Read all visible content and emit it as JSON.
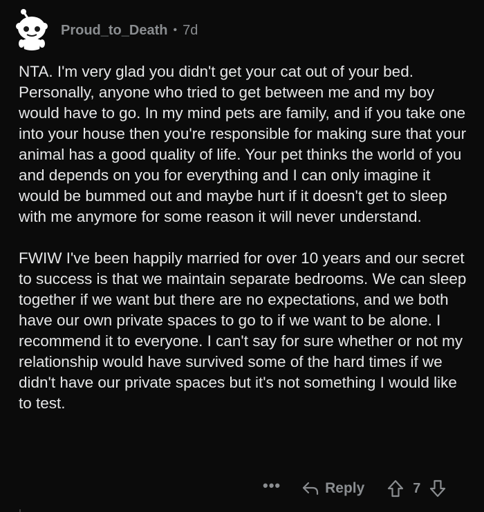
{
  "comment": {
    "author": "Proud_to_Death",
    "separator": "•",
    "age": "7d",
    "paragraphs": [
      "NTA. I'm very glad you didn't get your cat out of your bed. Personally, anyone who tried to get between me and my boy would have to go. In my mind pets are family, and if you take one into your house then you're responsible for making sure that your animal has a good quality of life. Your pet thinks the world of you and depends on you for everything and I can only imagine it would be bummed out and maybe hurt if it doesn't get to sleep with me anymore for some reason it will never understand.",
      "FWIW I've been happily married for over 10 years and our secret to success is that we maintain separate bedrooms. We can sleep together if we want but there are no expectations, and we both have our own private spaces to go to if we want to be alone. I recommend it to everyone. I can't say for sure whether or not my relationship would have survived some of the hard times if we didn't have our private spaces but it's not something I would like to test."
    ]
  },
  "actions": {
    "more_label": "•••",
    "reply_label": "Reply",
    "score": "7"
  },
  "icons": {
    "avatar": "snoo-avatar-icon",
    "reply": "reply-arrow-icon",
    "upvote": "upvote-arrow-icon",
    "downvote": "downvote-arrow-icon"
  },
  "colors": {
    "background": "#0b0b0b",
    "body_text": "#e6e7e8",
    "muted_text": "#8a8d90"
  }
}
